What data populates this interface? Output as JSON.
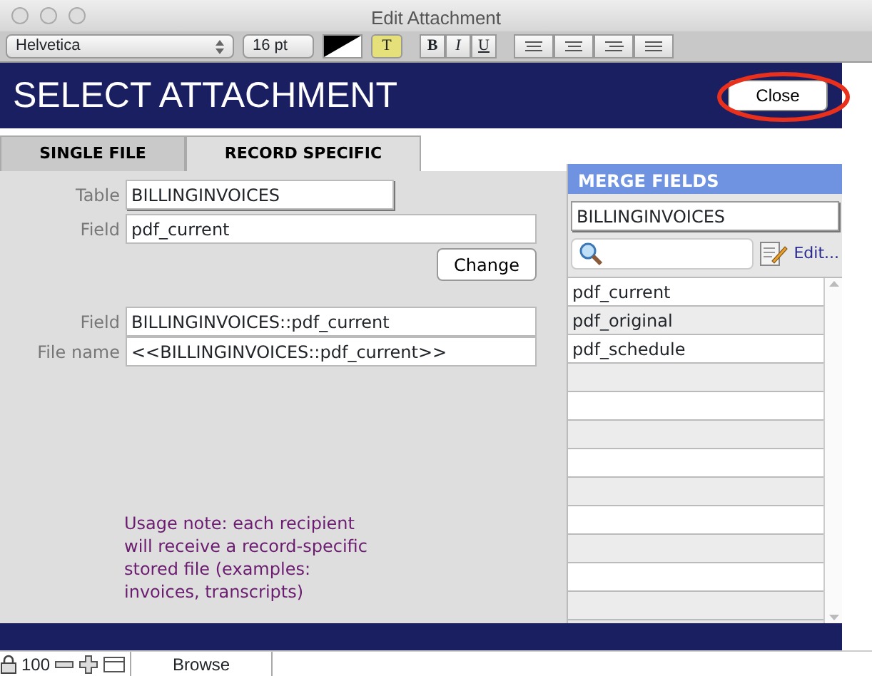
{
  "window": {
    "title": "Edit Attachment"
  },
  "toolbar": {
    "font": "Helvetica",
    "size": "16 pt",
    "text_tool": "T",
    "bold": "B",
    "italic": "I",
    "underline": "U"
  },
  "header": {
    "title": "SELECT ATTACHMENT",
    "close_button": "Close",
    "close_circled": true
  },
  "tabs": [
    {
      "label": "SINGLE FILE",
      "selected": false
    },
    {
      "label": "RECORD SPECIFIC",
      "selected": true
    }
  ],
  "form": {
    "table_label": "Table",
    "table_value": "BILLINGINVOICES",
    "field_label": "Field",
    "field_value": "pdf_current",
    "change_button": "Change",
    "result_field_label": "Field",
    "result_field_value": "BILLINGINVOICES::pdf_current",
    "file_name_label": "File name",
    "file_name_value": "<<BILLINGINVOICES::pdf_current>>",
    "note": "Usage note: each recipient\nwill receive a record-specific\nstored file (examples:\ninvoices, transcripts)"
  },
  "merge_fields": {
    "title": "MERGE FIELDS",
    "table": "BILLINGINVOICES",
    "edit_link": "Edit...",
    "items": [
      "pdf_current",
      "pdf_original",
      "pdf_schedule"
    ]
  },
  "status_bar": {
    "zoom": "100",
    "mode": "Browse"
  }
}
